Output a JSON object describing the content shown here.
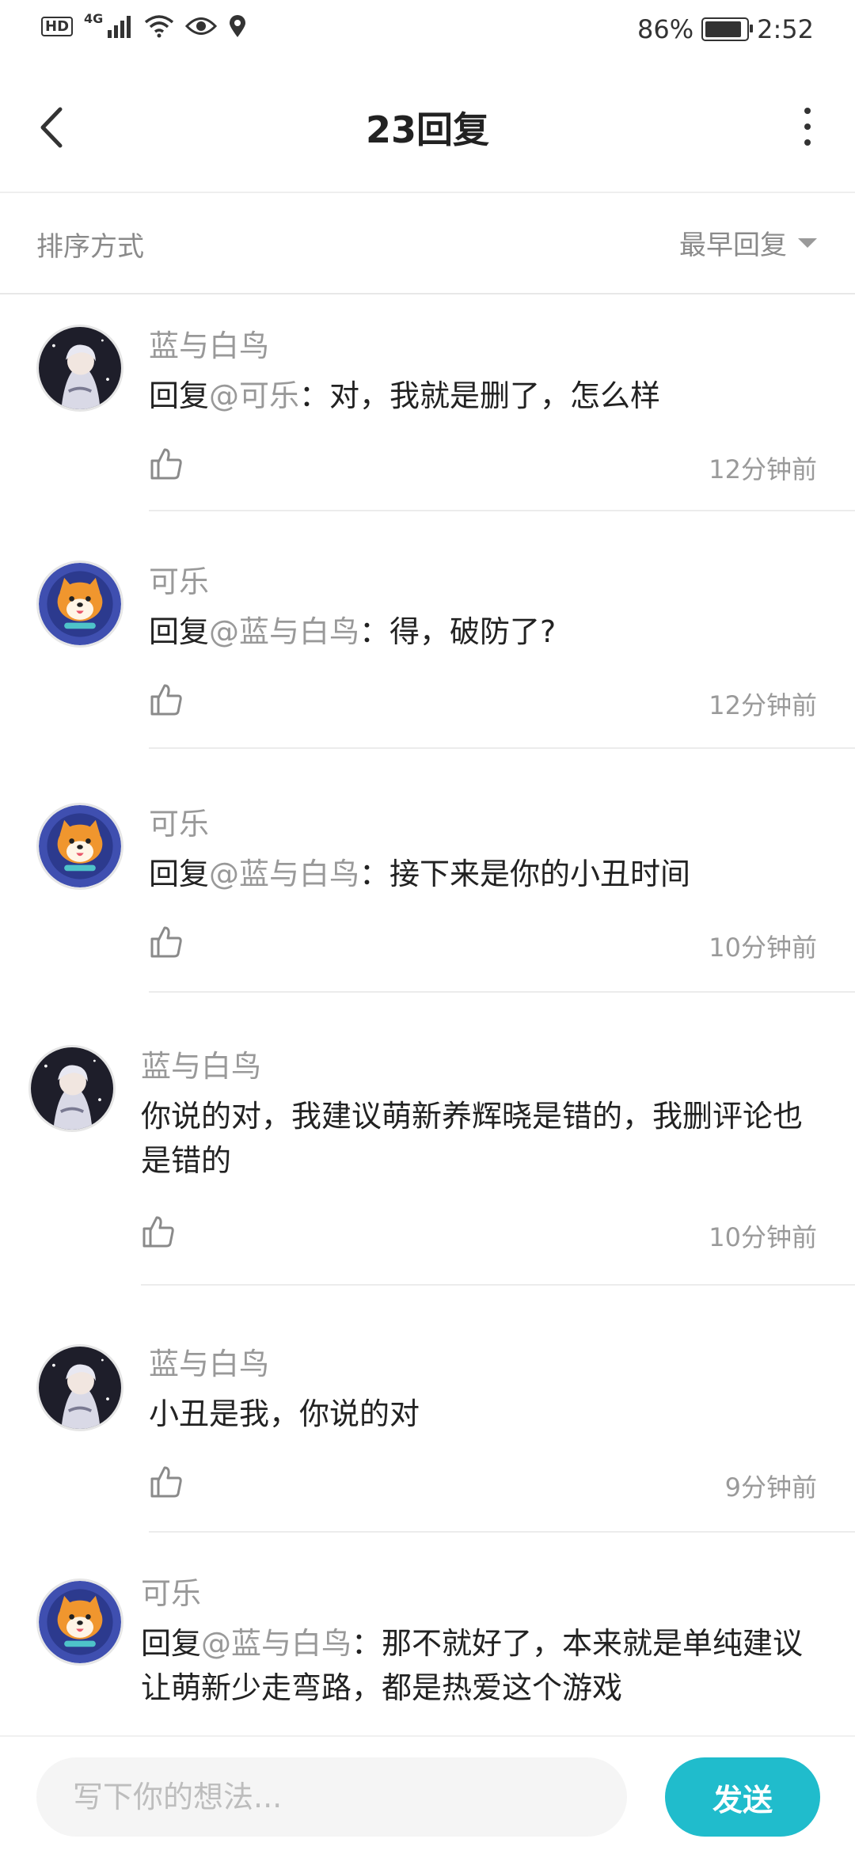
{
  "status_bar": {
    "hd": "HD",
    "network": "4G",
    "battery": "86%",
    "time": "2:52"
  },
  "header": {
    "title": "23回复"
  },
  "sort": {
    "label": "排序方式",
    "selected": "最早回复"
  },
  "comments": [
    {
      "author": "蓝与白鸟",
      "avatar": "anime-girl-avatar",
      "prefix": "回复",
      "mention": "@可乐",
      "text": "：对，我就是删了，怎么样",
      "time": "12分钟前"
    },
    {
      "author": "可乐",
      "avatar": "shiba-dog-avatar",
      "prefix": "回复",
      "mention": "@蓝与白鸟",
      "text": "：得，破防了?",
      "time": "12分钟前"
    },
    {
      "author": "可乐",
      "avatar": "shiba-dog-avatar",
      "prefix": "回复",
      "mention": "@蓝与白鸟",
      "text": "：接下来是你的小丑时间",
      "time": "10分钟前"
    },
    {
      "author": "蓝与白鸟",
      "avatar": "anime-girl-avatar",
      "prefix": "",
      "mention": "",
      "text": "你说的对，我建议萌新养辉晓是错的，我删评论也是错的",
      "time": "10分钟前"
    },
    {
      "author": "蓝与白鸟",
      "avatar": "anime-girl-avatar",
      "prefix": "",
      "mention": "",
      "text": "小丑是我，你说的对",
      "time": "9分钟前"
    },
    {
      "author": "可乐",
      "avatar": "shiba-dog-avatar",
      "prefix": "回复",
      "mention": "@蓝与白鸟",
      "text": "：那不就好了，本来就是单纯建议让萌新少走弯路，都是热爱这个游戏",
      "time": ""
    }
  ],
  "composer": {
    "placeholder": "写下你的想法...",
    "send_label": "发送"
  },
  "colors": {
    "accent": "#20bccc",
    "muted_text": "#999999",
    "body_text": "#222222"
  }
}
